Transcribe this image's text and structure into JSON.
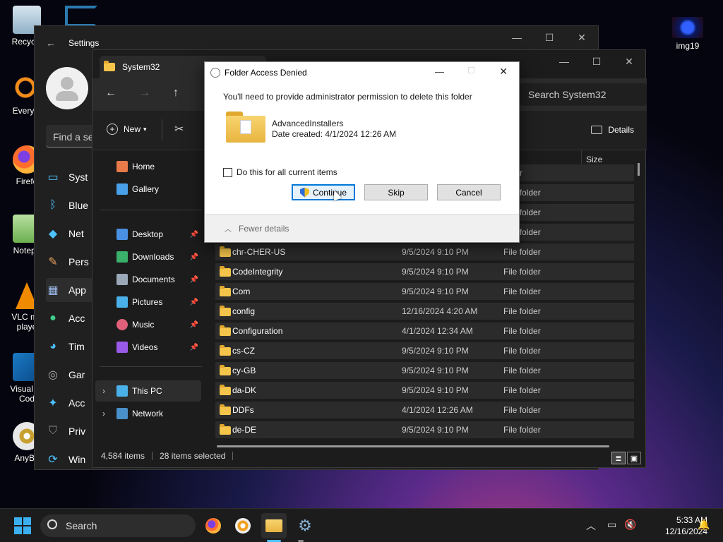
{
  "desktop": {
    "icons": [
      {
        "label": "Recycle",
        "icon": "recycle-bin-icon"
      },
      {
        "label": "Everyth",
        "icon": "everything-search-icon"
      },
      {
        "label": "Firefo",
        "icon": "firefox-icon"
      },
      {
        "label": "Notepa",
        "icon": "notepad-icon"
      },
      {
        "label": "VLC me",
        "label2": "playe",
        "icon": "vlc-icon"
      },
      {
        "label": "Visual St",
        "label2": "Cod",
        "icon": "vscode-icon"
      },
      {
        "label": "AnyBu",
        "icon": "anyburn-icon"
      }
    ],
    "img_icon_label": "img19"
  },
  "settings": {
    "title": "Settings",
    "search_placeholder": "Find a se",
    "nav": [
      "Syst",
      "Blue",
      "Net",
      "Pers",
      "App",
      "Acc",
      "Tim",
      "Gar",
      "Acc",
      "Priv",
      "Win"
    ]
  },
  "explorer": {
    "tab_title": "System32",
    "search_placeholder": "Search System32",
    "new_label": "New",
    "details_label": "Details",
    "size_header": "Size",
    "nav": {
      "home": "Home",
      "gallery": "Gallery",
      "desktop": "Desktop",
      "downloads": "Downloads",
      "documents": "Documents",
      "pictures": "Pictures",
      "music": "Music",
      "videos": "Videos",
      "this_pc": "This PC",
      "network": "Network"
    },
    "hidden_types": [
      "older",
      "File folder",
      "File folder",
      "File folder"
    ],
    "rows": [
      {
        "name": "chr-CHER-US",
        "date": "9/5/2024 9:10 PM",
        "type": "File folder"
      },
      {
        "name": "CodeIntegrity",
        "date": "9/5/2024 9:10 PM",
        "type": "File folder"
      },
      {
        "name": "Com",
        "date": "9/5/2024 9:10 PM",
        "type": "File folder"
      },
      {
        "name": "config",
        "date": "12/16/2024 4:20 AM",
        "type": "File folder"
      },
      {
        "name": "Configuration",
        "date": "4/1/2024 12:34 AM",
        "type": "File folder"
      },
      {
        "name": "cs-CZ",
        "date": "9/5/2024 9:10 PM",
        "type": "File folder"
      },
      {
        "name": "cy-GB",
        "date": "9/5/2024 9:10 PM",
        "type": "File folder"
      },
      {
        "name": "da-DK",
        "date": "9/5/2024 9:10 PM",
        "type": "File folder"
      },
      {
        "name": "DDFs",
        "date": "4/1/2024 12:26 AM",
        "type": "File folder"
      },
      {
        "name": "de-DE",
        "date": "9/5/2024 9:10 PM",
        "type": "File folder"
      }
    ],
    "status_items": "4,584 items",
    "status_selected": "28 items selected"
  },
  "dialog": {
    "title": "Folder Access Denied",
    "message": "You'll need to provide administrator permission to delete this folder",
    "folder_name": "AdvancedInstallers",
    "folder_date": "Date created: 4/1/2024 12:26 AM",
    "checkbox_label": "Do this for all current items",
    "continue_label": "Continue",
    "skip_label": "Skip",
    "cancel_label": "Cancel",
    "details_toggle": "Fewer details"
  },
  "taskbar": {
    "search_label": "Search",
    "time": "5:33 AM",
    "date": "12/16/2024"
  }
}
